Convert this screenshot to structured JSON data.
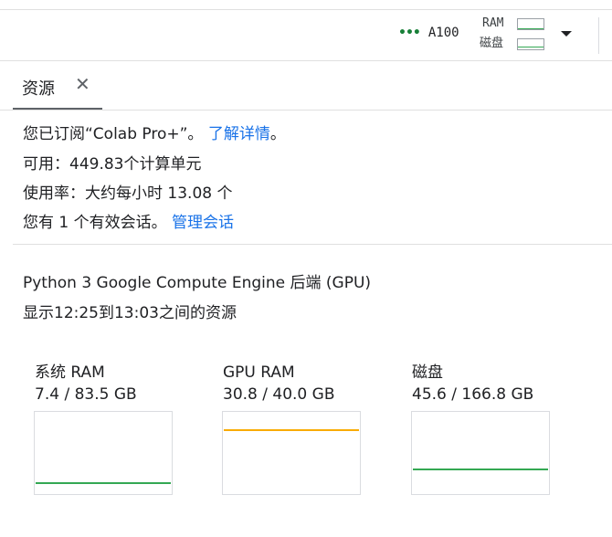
{
  "toolbar": {
    "connection_dots": "•••",
    "runtime_name": "A100",
    "ram_label": "RAM",
    "disk_label": "磁盘",
    "ram_fraction": 0.09,
    "disk_fraction": 0.27
  },
  "tab": {
    "label": "资源",
    "close_symbol": "✕"
  },
  "subscription": {
    "text": "您已订阅“Colab Pro+”。",
    "link": "了解详情",
    "suffix": "。"
  },
  "available": "可用：449.83个计算单元",
  "usage_rate": "使用率：大约每小时 13.08 个",
  "sessions": {
    "text": "您有 1 个有效会话。",
    "link": "管理会话"
  },
  "backend_title": "Python 3 Google Compute Engine 后端 (GPU)",
  "time_range": "显示12:25到13:03之间的资源",
  "metrics": [
    {
      "title": "系统 RAM",
      "value": "7.4 / 83.5 GB",
      "fraction": 0.089,
      "color": "#34a853"
    },
    {
      "title": "GPU RAM",
      "value": "30.8 / 40.0 GB",
      "fraction": 0.77,
      "color": "#f9ab00"
    },
    {
      "title": "磁盘",
      "value": "45.6 / 166.8 GB",
      "fraction": 0.273,
      "color": "#34a853"
    }
  ]
}
